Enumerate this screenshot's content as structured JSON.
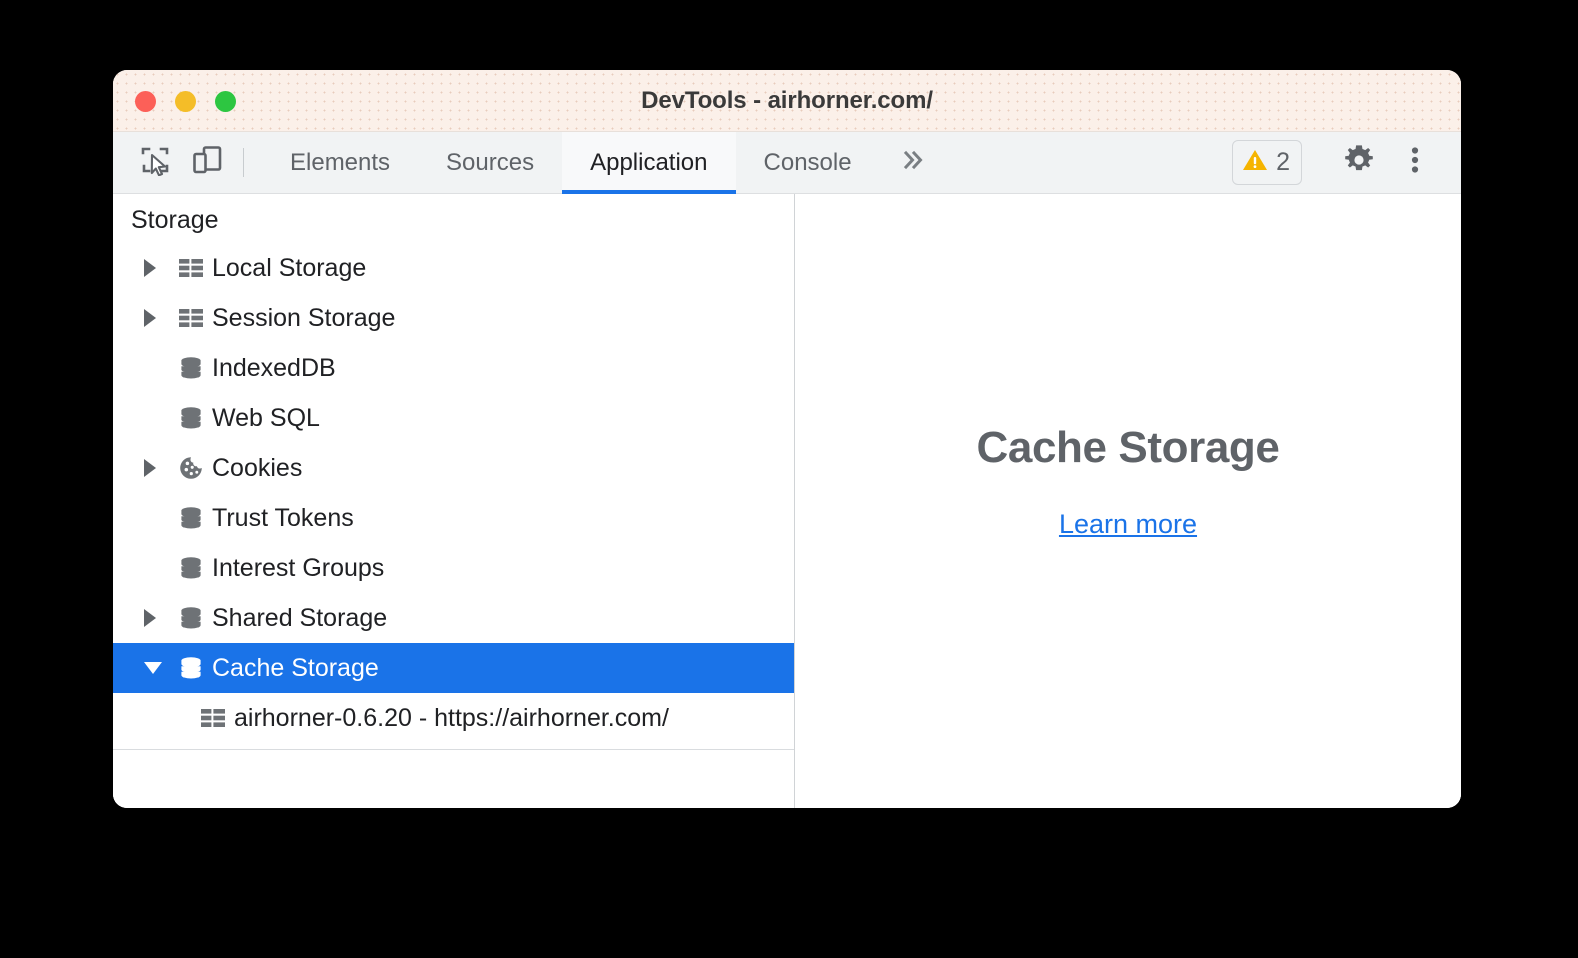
{
  "window": {
    "title": "DevTools - airhorner.com/",
    "traffic_lights": [
      {
        "name": "close",
        "color": "#fc6058"
      },
      {
        "name": "minimize",
        "color": "#f4bd28"
      },
      {
        "name": "maximize",
        "color": "#2dc641"
      }
    ]
  },
  "toolbar": {
    "inspect_icon": "inspect-element-icon",
    "device_icon": "device-toolbar-icon",
    "tabs": [
      {
        "label": "Elements",
        "active": false
      },
      {
        "label": "Sources",
        "active": false
      },
      {
        "label": "Application",
        "active": true
      },
      {
        "label": "Console",
        "active": false
      }
    ],
    "more_tabs_label": "»",
    "warning_icon": "warning-triangle-icon",
    "warning_count": "2",
    "settings_icon": "gear-icon",
    "menu_icon": "more-vertical-icon",
    "accent_color": "#1a73e8",
    "warning_color": "#f5b400"
  },
  "sidebar": {
    "section_title": "Storage",
    "items": [
      {
        "label": "Local Storage",
        "icon": "table-grid-icon",
        "twisty": "right",
        "indent": 0,
        "selected": false
      },
      {
        "label": "Session Storage",
        "icon": "table-grid-icon",
        "twisty": "right",
        "indent": 0,
        "selected": false
      },
      {
        "label": "IndexedDB",
        "icon": "database-icon",
        "twisty": "none",
        "indent": 0,
        "selected": false
      },
      {
        "label": "Web SQL",
        "icon": "database-icon",
        "twisty": "none",
        "indent": 0,
        "selected": false
      },
      {
        "label": "Cookies",
        "icon": "cookie-icon",
        "twisty": "right",
        "indent": 0,
        "selected": false
      },
      {
        "label": "Trust Tokens",
        "icon": "database-icon",
        "twisty": "none",
        "indent": 0,
        "selected": false
      },
      {
        "label": "Interest Groups",
        "icon": "database-icon",
        "twisty": "none",
        "indent": 0,
        "selected": false
      },
      {
        "label": "Shared Storage",
        "icon": "database-icon",
        "twisty": "right",
        "indent": 0,
        "selected": false
      },
      {
        "label": "Cache Storage",
        "icon": "database-icon",
        "twisty": "down",
        "indent": 0,
        "selected": true
      },
      {
        "label": "airhorner-0.6.20 - https://airhorner.com/",
        "icon": "table-grid-icon",
        "twisty": "none",
        "indent": 1,
        "selected": false
      }
    ],
    "selected_color": "#1a73e8"
  },
  "main": {
    "empty_title": "Cache Storage",
    "learn_more_label": "Learn more",
    "link_color": "#1a73e8"
  }
}
